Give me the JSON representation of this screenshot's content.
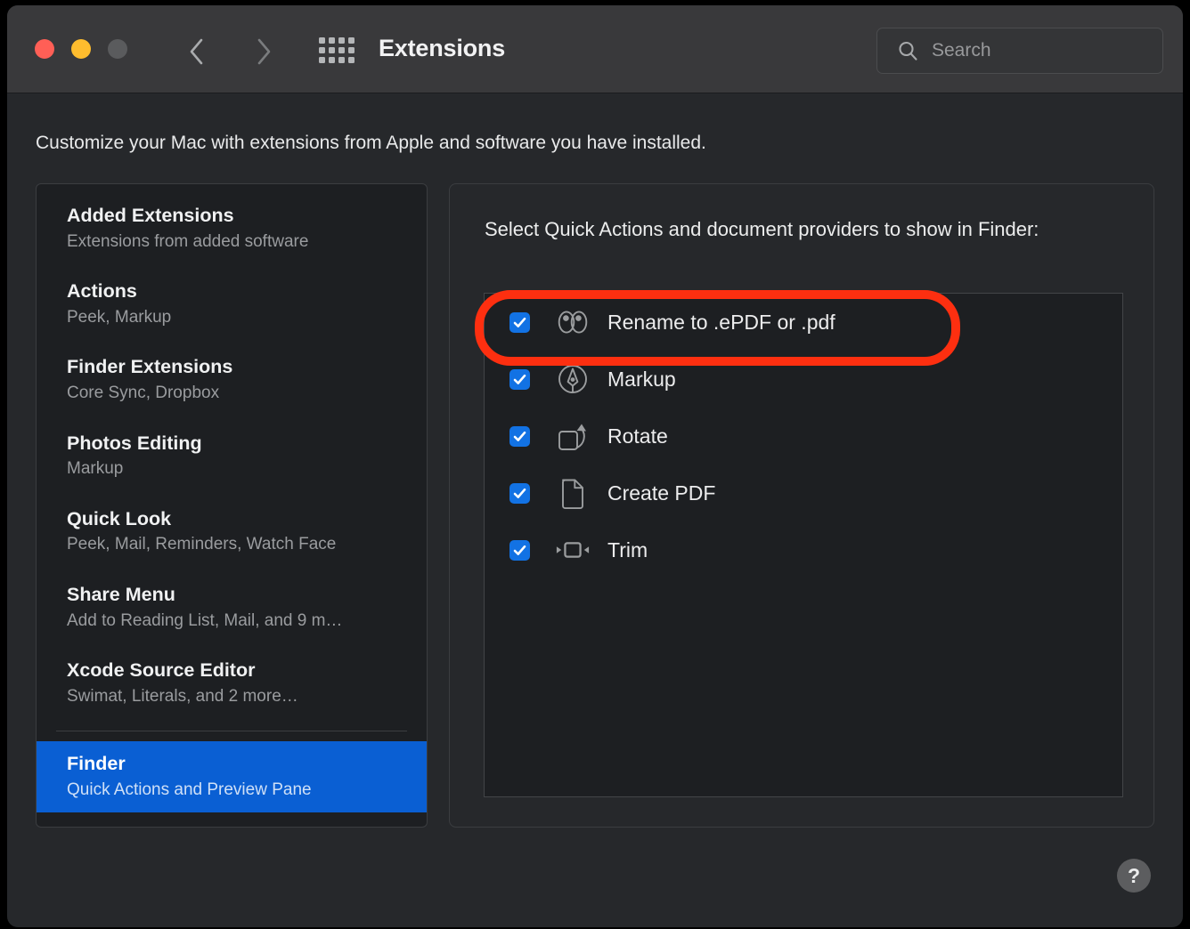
{
  "window": {
    "title": "Extensions",
    "traffic_lights": [
      "close-red",
      "minimize-yellow",
      "zoom-disabled-gray"
    ],
    "back_icon": "chevron-left-icon",
    "forward_icon": "chevron-right-icon",
    "grid_icon": "show-all-grid-icon"
  },
  "search": {
    "icon": "search-icon",
    "placeholder": "Search",
    "value": ""
  },
  "intro": "Customize your Mac with extensions from Apple and software you have installed.",
  "sidebar": {
    "items": [
      {
        "title": "Added Extensions",
        "subtitle": "Extensions from added software",
        "selected": false
      },
      {
        "title": "Actions",
        "subtitle": "Peek, Markup",
        "selected": false
      },
      {
        "title": "Finder Extensions",
        "subtitle": "Core Sync, Dropbox",
        "selected": false
      },
      {
        "title": "Photos Editing",
        "subtitle": "Markup",
        "selected": false
      },
      {
        "title": "Quick Look",
        "subtitle": "Peek, Mail, Reminders, Watch Face",
        "selected": false
      },
      {
        "title": "Share Menu",
        "subtitle": "Add to Reading List, Mail, and 9 m…",
        "selected": false
      },
      {
        "title": "Xcode Source Editor",
        "subtitle": "Swimat, Literals, and 2 more…",
        "selected": false
      },
      {
        "title": "Finder",
        "subtitle": "Quick Actions and Preview Pane",
        "selected": true
      }
    ]
  },
  "detail": {
    "heading": "Select Quick Actions and document providers to show in Finder:",
    "rows": [
      {
        "label": "Rename to .ePDF or .pdf",
        "checked": true,
        "icon": "eyes-icon",
        "annotated": true
      },
      {
        "label": "Markup",
        "checked": true,
        "icon": "markup-pen-icon",
        "annotated": false
      },
      {
        "label": "Rotate",
        "checked": true,
        "icon": "rotate-icon",
        "annotated": false
      },
      {
        "label": "Create PDF",
        "checked": true,
        "icon": "document-icon",
        "annotated": false
      },
      {
        "label": "Trim",
        "checked": true,
        "icon": "trim-icon",
        "annotated": false
      }
    ]
  },
  "help": {
    "label": "?"
  },
  "colors": {
    "accent_blue": "#1272e4",
    "selection_blue": "#0a5fd3",
    "annotation_red": "#fd2f10",
    "window_bg": "#26282b",
    "panel_bg": "#1d1f22",
    "titlebar_bg": "#39393b"
  }
}
